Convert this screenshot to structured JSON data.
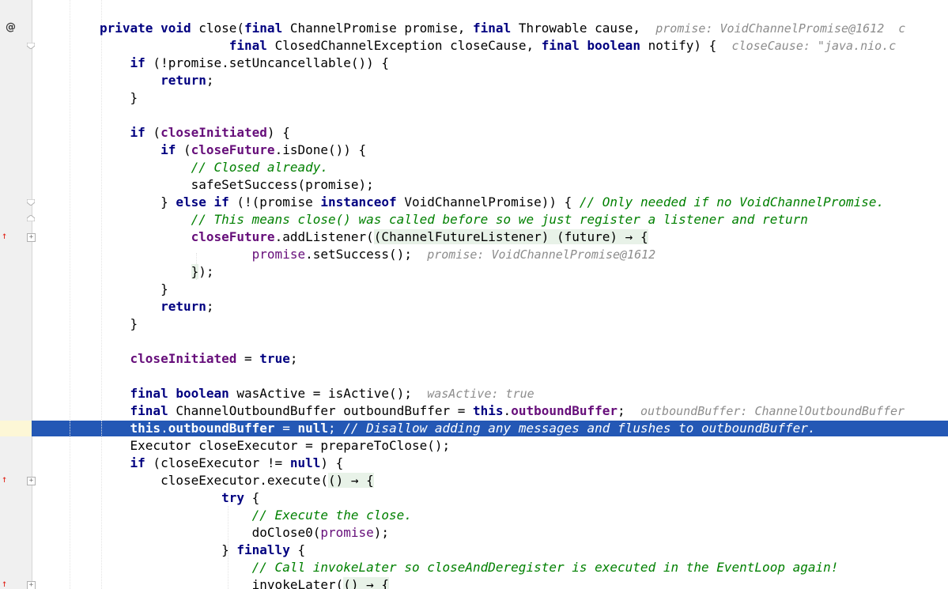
{
  "editor": {
    "gutter": {
      "override_marker": "@",
      "implements_marker": "↑",
      "fold_marker": "+"
    },
    "lines": [
      {
        "id": "l0",
        "segments": [
          {
            "t": "private void",
            "c": "kw"
          },
          {
            "t": " close("
          },
          {
            "t": "final",
            "c": "kw"
          },
          {
            "t": " ChannelPromise promise, "
          },
          {
            "t": "final",
            "c": "kw"
          },
          {
            "t": " Throwable cause,  "
          },
          {
            "t": "promise: VoidChannelPromise@1612  c",
            "c": "hint"
          }
        ]
      },
      {
        "id": "l1",
        "segments": [
          {
            "t": "                 "
          },
          {
            "t": "final",
            "c": "kw"
          },
          {
            "t": " ClosedChannelException closeCause, "
          },
          {
            "t": "final boolean",
            "c": "kw"
          },
          {
            "t": " notify) {  "
          },
          {
            "t": "closeCause: \"java.nio.c",
            "c": "hint"
          }
        ]
      },
      {
        "id": "l2",
        "segments": [
          {
            "t": "    "
          },
          {
            "t": "if",
            "c": "kw"
          },
          {
            "t": " (!promise.setUncancellable()) {"
          }
        ]
      },
      {
        "id": "l3",
        "segments": [
          {
            "t": "        "
          },
          {
            "t": "return",
            "c": "kw"
          },
          {
            "t": ";"
          }
        ]
      },
      {
        "id": "l4",
        "segments": [
          {
            "t": "    }"
          }
        ]
      },
      {
        "id": "l5",
        "segments": []
      },
      {
        "id": "l6",
        "segments": [
          {
            "t": "    "
          },
          {
            "t": "if",
            "c": "kw"
          },
          {
            "t": " ("
          },
          {
            "t": "closeInitiated",
            "c": "fld"
          },
          {
            "t": ") {"
          }
        ]
      },
      {
        "id": "l7",
        "segments": [
          {
            "t": "        "
          },
          {
            "t": "if",
            "c": "kw"
          },
          {
            "t": " ("
          },
          {
            "t": "closeFuture",
            "c": "fld"
          },
          {
            "t": ".isDone()) {"
          }
        ]
      },
      {
        "id": "l8",
        "segments": [
          {
            "t": "            "
          },
          {
            "t": "// Closed already.",
            "c": "cmt"
          }
        ]
      },
      {
        "id": "l9",
        "segments": [
          {
            "t": "            safeSetSuccess(promise);"
          }
        ]
      },
      {
        "id": "l10",
        "segments": [
          {
            "t": "        } "
          },
          {
            "t": "else if",
            "c": "kw"
          },
          {
            "t": " (!(promise "
          },
          {
            "t": "instanceof",
            "c": "kw"
          },
          {
            "t": " VoidChannelPromise)) { "
          },
          {
            "t": "// Only needed if no VoidChannelPromise.",
            "c": "cmt"
          }
        ]
      },
      {
        "id": "l11",
        "segments": [
          {
            "t": "            "
          },
          {
            "t": "// This means close() was called before so we just register a listener and return",
            "c": "cmt"
          }
        ]
      },
      {
        "id": "l12",
        "segments": [
          {
            "t": "            "
          },
          {
            "t": "closeFuture",
            "c": "fld"
          },
          {
            "t": ".addListener("
          },
          {
            "t": "(ChannelFutureListener) (future) → {",
            "c": "lam"
          }
        ]
      },
      {
        "id": "l13",
        "segments": [
          {
            "t": "                    "
          },
          {
            "t": "promise",
            "c": "fldn"
          },
          {
            "t": ".setSuccess();  "
          },
          {
            "t": "promise: VoidChannelPromise@1612",
            "c": "hint"
          }
        ]
      },
      {
        "id": "l14",
        "segments": [
          {
            "t": "            "
          },
          {
            "t": "}",
            "c": "lam"
          },
          {
            "t": ");"
          }
        ]
      },
      {
        "id": "l15",
        "segments": [
          {
            "t": "        }"
          }
        ]
      },
      {
        "id": "l16",
        "segments": [
          {
            "t": "        "
          },
          {
            "t": "return",
            "c": "kw"
          },
          {
            "t": ";"
          }
        ]
      },
      {
        "id": "l17",
        "segments": [
          {
            "t": "    }"
          }
        ]
      },
      {
        "id": "l18",
        "segments": []
      },
      {
        "id": "l19",
        "segments": [
          {
            "t": "    "
          },
          {
            "t": "closeInitiated",
            "c": "fld"
          },
          {
            "t": " = "
          },
          {
            "t": "true",
            "c": "kw"
          },
          {
            "t": ";"
          }
        ]
      },
      {
        "id": "l20",
        "segments": []
      },
      {
        "id": "l21",
        "segments": [
          {
            "t": "    "
          },
          {
            "t": "final boolean",
            "c": "kw"
          },
          {
            "t": " wasActive = isActive();  "
          },
          {
            "t": "wasActive: true",
            "c": "hint"
          }
        ]
      },
      {
        "id": "l22",
        "segments": [
          {
            "t": "    "
          },
          {
            "t": "final",
            "c": "kw"
          },
          {
            "t": " ChannelOutboundBuffer outboundBuffer = "
          },
          {
            "t": "this",
            "c": "kw"
          },
          {
            "t": "."
          },
          {
            "t": "outboundBuffer",
            "c": "fld"
          },
          {
            "t": ";  "
          },
          {
            "t": "outboundBuffer: ChannelOutboundBuffer",
            "c": "hint"
          }
        ]
      },
      {
        "id": "l23",
        "selected": true,
        "segments": [
          {
            "t": "    "
          },
          {
            "t": "this",
            "c": "kw"
          },
          {
            "t": "."
          },
          {
            "t": "outboundBuffer",
            "c": "fld"
          },
          {
            "t": " = "
          },
          {
            "t": "null",
            "c": "kw"
          },
          {
            "t": "; "
          },
          {
            "t": "// Disallow adding any messages and flushes to outboundBuffer.",
            "c": "cmt"
          }
        ]
      },
      {
        "id": "l24",
        "segments": [
          {
            "t": "    Executor closeExecutor = prepareToClose();"
          }
        ]
      },
      {
        "id": "l25",
        "segments": [
          {
            "t": "    "
          },
          {
            "t": "if",
            "c": "kw"
          },
          {
            "t": " (closeExecutor != "
          },
          {
            "t": "null",
            "c": "kw"
          },
          {
            "t": ") {"
          }
        ]
      },
      {
        "id": "l26",
        "segments": [
          {
            "t": "        closeExecutor.execute("
          },
          {
            "t": "() → {",
            "c": "lam"
          }
        ]
      },
      {
        "id": "l27",
        "segments": [
          {
            "t": "                "
          },
          {
            "t": "try",
            "c": "kw"
          },
          {
            "t": " {"
          }
        ]
      },
      {
        "id": "l28",
        "segments": [
          {
            "t": "                    "
          },
          {
            "t": "// Execute the close.",
            "c": "cmt"
          }
        ]
      },
      {
        "id": "l29",
        "segments": [
          {
            "t": "                    doClose0("
          },
          {
            "t": "promise",
            "c": "fldn"
          },
          {
            "t": ");"
          }
        ]
      },
      {
        "id": "l30",
        "segments": [
          {
            "t": "                } "
          },
          {
            "t": "finally",
            "c": "kw"
          },
          {
            "t": " {"
          }
        ]
      },
      {
        "id": "l31",
        "segments": [
          {
            "t": "                    "
          },
          {
            "t": "// Call invokeLater so closeAndDeregister is executed in the EventLoop again!",
            "c": "cmt"
          }
        ]
      },
      {
        "id": "l32",
        "segments": [
          {
            "t": "                    invokeLater("
          },
          {
            "t": "() → {",
            "c": "lam"
          }
        ]
      }
    ]
  }
}
